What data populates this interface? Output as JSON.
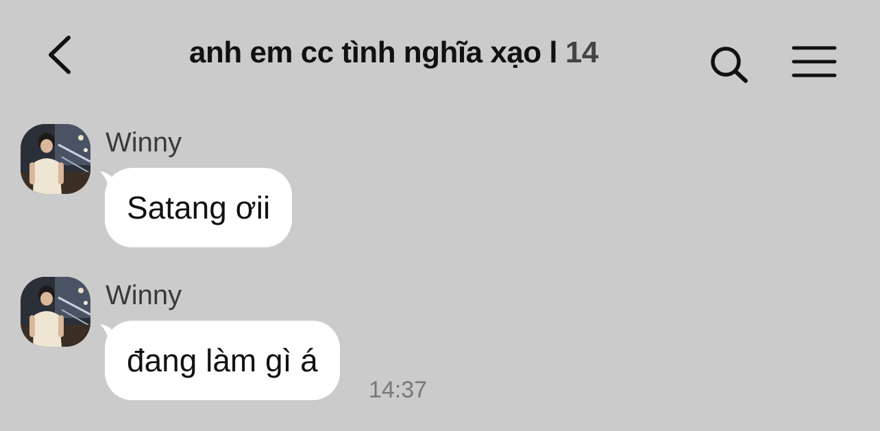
{
  "header": {
    "title": "anh em cc tình nghĩa xạo l",
    "member_count": "14",
    "back_icon": "chevron-left-icon",
    "search_icon": "search-icon",
    "menu_icon": "hamburger-menu-icon"
  },
  "messages": [
    {
      "sender": "Winny",
      "text": "Satang ơii",
      "time": ""
    },
    {
      "sender": "Winny",
      "text": "đang làm gì á",
      "time": "14:37"
    }
  ],
  "colors": {
    "background": "#cbcbcb",
    "bubble": "#ffffff",
    "text": "#111111",
    "sender": "#3a3a3a",
    "time": "#777777"
  }
}
